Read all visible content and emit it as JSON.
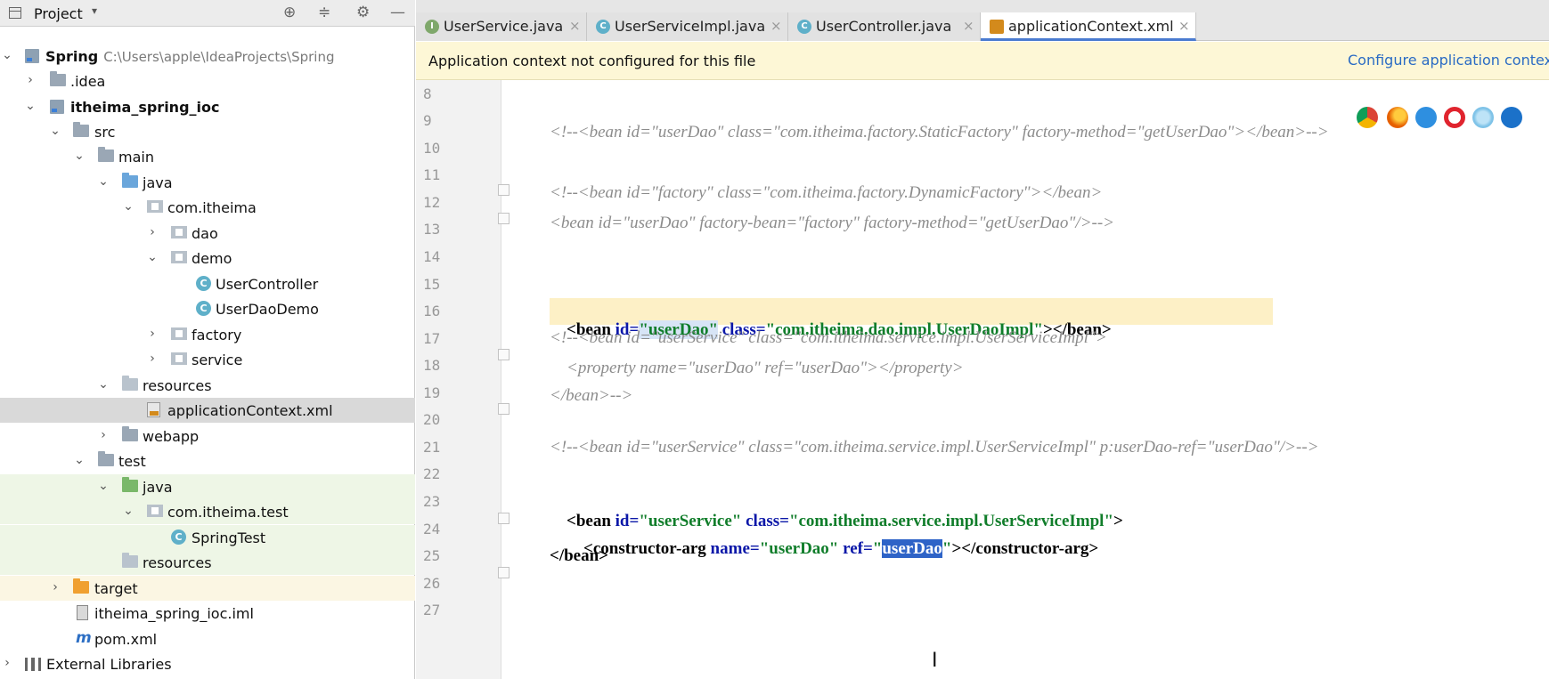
{
  "project_panel": {
    "title": "Project",
    "dropdown": "▾",
    "buttons": {
      "locate": "⊕",
      "collapse": "≑",
      "settings": "⚙",
      "hide": "—"
    },
    "tree": [
      {
        "label": "Spring",
        "path": "C:\\Users\\apple\\IdeaProjects\\Spring",
        "bold": true,
        "expanded": "⌄"
      },
      {
        "label": ".idea",
        "expanded": "›"
      },
      {
        "label": "itheima_spring_ioc",
        "bold": true,
        "expanded": "⌄"
      },
      {
        "label": "src",
        "expanded": "⌄"
      },
      {
        "label": "main",
        "expanded": "⌄"
      },
      {
        "label": "java",
        "expanded": "⌄"
      },
      {
        "label": "com.itheima",
        "expanded": "⌄"
      },
      {
        "label": "dao",
        "expanded": "›"
      },
      {
        "label": "demo",
        "expanded": "⌄"
      },
      {
        "label": "UserController"
      },
      {
        "label": "UserDaoDemo"
      },
      {
        "label": "factory",
        "expanded": "›"
      },
      {
        "label": "service",
        "expanded": "›"
      },
      {
        "label": "resources",
        "expanded": "⌄"
      },
      {
        "label": "applicationContext.xml"
      },
      {
        "label": "webapp",
        "expanded": "›"
      },
      {
        "label": "test",
        "expanded": "⌄"
      },
      {
        "label": "java",
        "expanded": "⌄"
      },
      {
        "label": "com.itheima.test",
        "expanded": "⌄"
      },
      {
        "label": "SpringTest"
      },
      {
        "label": "resources"
      },
      {
        "label": "target",
        "expanded": "›"
      },
      {
        "label": "itheima_spring_ioc.iml"
      },
      {
        "label": "pom.xml"
      },
      {
        "label": "External Libraries",
        "expanded": "›"
      }
    ],
    "icons": {
      "class_glyph": "C",
      "maven_glyph": "m"
    }
  },
  "tabs": [
    {
      "label": "UserService.java",
      "icon": "I",
      "icon_color": "#7fa86b",
      "close": "×"
    },
    {
      "label": "UserServiceImpl.java",
      "icon": "C",
      "icon_color": "#5fb0c9",
      "close": "×"
    },
    {
      "label": "UserController.java",
      "icon": "C",
      "icon_color": "#5fb0c9",
      "close": "×"
    },
    {
      "label": "applicationContext.xml",
      "icon": "",
      "icon_color": "#d38a1c",
      "close": "×"
    }
  ],
  "notification": {
    "message": "Application context not configured for this file",
    "action": "Configure application contex"
  },
  "editor": {
    "line_numbers": [
      "8",
      "9",
      "10",
      "11",
      "12",
      "13",
      "14",
      "15",
      "16",
      "17",
      "18",
      "19",
      "20",
      "21",
      "22",
      "23",
      "24",
      "25",
      "26",
      "27"
    ],
    "lines": {
      "l9": "<!--<bean id=\"userDao\" class=\"com.itheima.factory.StaticFactory\" factory-method=\"getUserDao\"></bean>-->",
      "l11": "<!--<bean id=\"factory\" class=\"com.itheima.factory.DynamicFactory\"></bean>",
      "l12": "<bean id=\"userDao\" factory-bean=\"factory\" factory-method=\"getUserDao\"/>-->",
      "l15_open": "<bean",
      "l15_attr1": " id=",
      "l15_val1": "\"userDao\"",
      "l15_attr2": " class=",
      "l15_val2": "\"com.itheima.dao.impl.UserDaoImpl\"",
      "l15_close": "></bean>",
      "l17": "<!--<bean id=\"userService\" class=\"com.itheima.service.impl.UserServiceImpl\">",
      "l18": "    <property name=\"userDao\" ref=\"userDao\"></property>",
      "l19": "</bean>-->",
      "l21": "<!--<bean id=\"userService\" class=\"com.itheima.service.impl.UserServiceImpl\" p:userDao-ref=\"userDao\"/>-->",
      "l23_open": "<bean",
      "l23_attr1": " id=",
      "l23_val1": "\"userService\"",
      "l23_attr2": " class=",
      "l23_val2": "\"com.itheima.service.impl.UserServiceImpl\"",
      "l23_close": ">",
      "l24_open": "    <constructor-arg",
      "l24_attr1": " name=",
      "l24_val1": "\"userDao\"",
      "l24_attr2": " ref=",
      "l24_q1": "\"",
      "l24_sel": "userDao",
      "l24_q2": "\"",
      "l24_close": "></constructor-arg>",
      "l25": "</bean>"
    },
    "cursor": "I"
  },
  "browser_icons": [
    "chrome-icon",
    "firefox-icon",
    "safari-icon",
    "opera-icon",
    "ie-icon",
    "edge-icon"
  ],
  "colors": {
    "accent": "#4a7bd0",
    "notification_bg": "#fdf7d6",
    "selected_row": "#d9d9d9",
    "test_bg": "#eef6e6",
    "target_bg": "#fbf6e3"
  }
}
